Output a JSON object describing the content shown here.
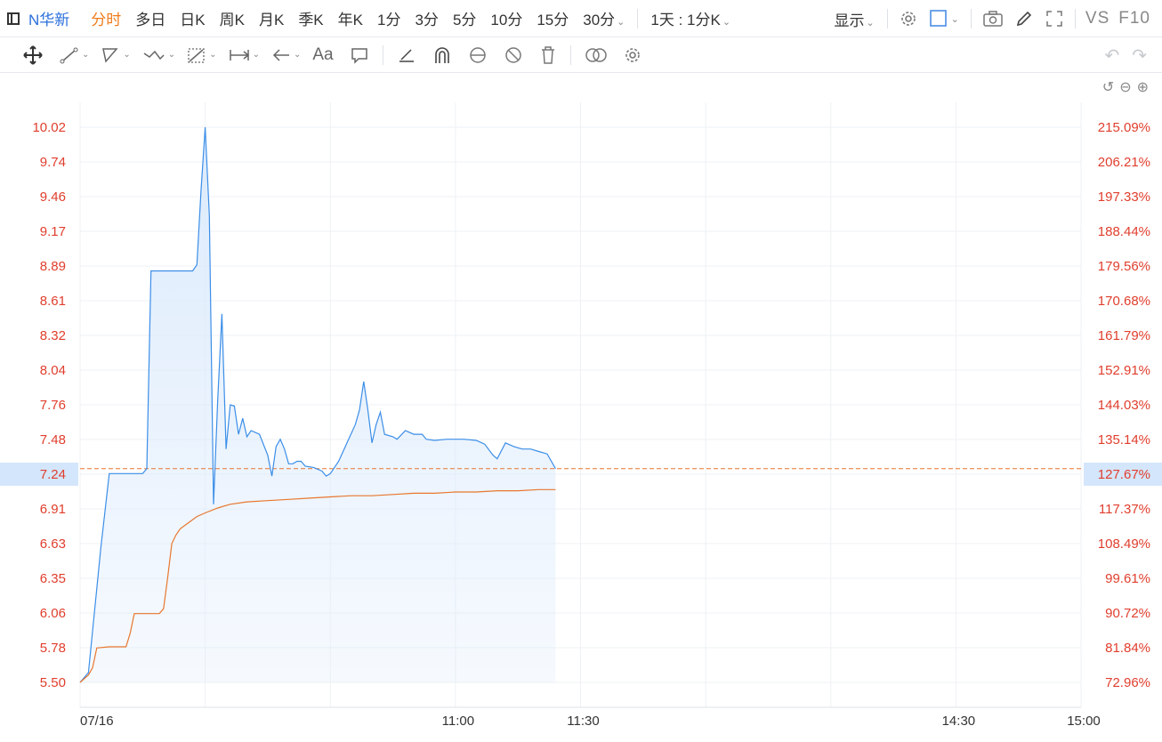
{
  "toolbar": {
    "symbol": "N华新",
    "periods": [
      "分时",
      "多日",
      "日K",
      "周K",
      "月K",
      "季K",
      "年K",
      "1分",
      "3分",
      "5分",
      "10分",
      "15分",
      "30分"
    ],
    "active_period": "分时",
    "range_label": "1天 : 1分K",
    "display_label": "显示",
    "vs_label": "VS",
    "f10_label": "F10"
  },
  "colors": {
    "price_line": "#3b8ee8",
    "avg_line": "#e8772e",
    "area_fill": "#dbeafc",
    "grid": "#eef1f4",
    "tick_red": "#e03e2d",
    "current_bg": "#d4e6fb"
  },
  "chart_data": {
    "type": "line",
    "y_left_ticks": [
      "10.02",
      "9.74",
      "9.46",
      "9.17",
      "8.89",
      "8.61",
      "8.32",
      "8.04",
      "7.76",
      "7.48",
      "7.24",
      "6.91",
      "6.63",
      "6.35",
      "6.06",
      "5.78",
      "5.50"
    ],
    "y_right_ticks": [
      "215.09%",
      "206.21%",
      "197.33%",
      "188.44%",
      "179.56%",
      "170.68%",
      "161.79%",
      "152.91%",
      "144.03%",
      "135.14%",
      "127.67%",
      "117.37%",
      "108.49%",
      "99.61%",
      "90.72%",
      "81.84%",
      "72.96%"
    ],
    "x_ticks": [
      "07/16",
      "11:00",
      "11:30",
      "14:30",
      "15:00"
    ],
    "current_price": 7.24,
    "current_pct": "127.67%",
    "ylim": [
      5.5,
      10.02
    ],
    "price_series": [
      [
        0,
        5.5
      ],
      [
        2,
        5.58
      ],
      [
        5,
        6.6
      ],
      [
        7,
        7.2
      ],
      [
        10,
        7.2
      ],
      [
        12,
        7.2
      ],
      [
        15,
        7.2
      ],
      [
        16,
        7.24
      ],
      [
        17,
        8.85
      ],
      [
        27,
        8.85
      ],
      [
        28,
        8.9
      ],
      [
        29,
        9.5
      ],
      [
        30,
        10.02
      ],
      [
        31,
        9.3
      ],
      [
        32,
        6.95
      ],
      [
        33,
        7.8
      ],
      [
        34,
        8.5
      ],
      [
        35,
        7.4
      ],
      [
        36,
        7.76
      ],
      [
        37,
        7.75
      ],
      [
        38,
        7.52
      ],
      [
        39,
        7.65
      ],
      [
        40,
        7.5
      ],
      [
        41,
        7.55
      ],
      [
        43,
        7.52
      ],
      [
        45,
        7.35
      ],
      [
        46,
        7.18
      ],
      [
        47,
        7.42
      ],
      [
        48,
        7.48
      ],
      [
        49,
        7.4
      ],
      [
        50,
        7.28
      ],
      [
        51,
        7.28
      ],
      [
        52,
        7.3
      ],
      [
        53,
        7.3
      ],
      [
        54,
        7.26
      ],
      [
        56,
        7.25
      ],
      [
        58,
        7.22
      ],
      [
        59,
        7.18
      ],
      [
        60,
        7.2
      ],
      [
        62,
        7.3
      ],
      [
        64,
        7.45
      ],
      [
        66,
        7.6
      ],
      [
        67,
        7.72
      ],
      [
        68,
        7.95
      ],
      [
        69,
        7.72
      ],
      [
        70,
        7.45
      ],
      [
        71,
        7.6
      ],
      [
        72,
        7.7
      ],
      [
        73,
        7.52
      ],
      [
        75,
        7.5
      ],
      [
        76,
        7.48
      ],
      [
        78,
        7.55
      ],
      [
        80,
        7.52
      ],
      [
        82,
        7.52
      ],
      [
        83,
        7.48
      ],
      [
        85,
        7.47
      ],
      [
        88,
        7.48
      ],
      [
        92,
        7.48
      ],
      [
        95,
        7.47
      ],
      [
        97,
        7.44
      ],
      [
        99,
        7.35
      ],
      [
        100,
        7.32
      ],
      [
        102,
        7.45
      ],
      [
        104,
        7.42
      ],
      [
        106,
        7.4
      ],
      [
        108,
        7.4
      ],
      [
        110,
        7.38
      ],
      [
        112,
        7.36
      ],
      [
        114,
        7.24
      ]
    ],
    "avg_series": [
      [
        0,
        5.5
      ],
      [
        2,
        5.56
      ],
      [
        3,
        5.62
      ],
      [
        4,
        5.78
      ],
      [
        7,
        5.79
      ],
      [
        10,
        5.79
      ],
      [
        11,
        5.79
      ],
      [
        12,
        5.9
      ],
      [
        13,
        6.06
      ],
      [
        19,
        6.06
      ],
      [
        20,
        6.1
      ],
      [
        21,
        6.35
      ],
      [
        22,
        6.63
      ],
      [
        23,
        6.7
      ],
      [
        24,
        6.75
      ],
      [
        26,
        6.8
      ],
      [
        28,
        6.85
      ],
      [
        30,
        6.88
      ],
      [
        33,
        6.92
      ],
      [
        36,
        6.95
      ],
      [
        40,
        6.97
      ],
      [
        45,
        6.98
      ],
      [
        50,
        6.99
      ],
      [
        55,
        7.0
      ],
      [
        60,
        7.01
      ],
      [
        65,
        7.02
      ],
      [
        70,
        7.02
      ],
      [
        75,
        7.03
      ],
      [
        80,
        7.04
      ],
      [
        85,
        7.04
      ],
      [
        90,
        7.05
      ],
      [
        95,
        7.05
      ],
      [
        100,
        7.06
      ],
      [
        105,
        7.06
      ],
      [
        110,
        7.07
      ],
      [
        114,
        7.07
      ]
    ]
  }
}
